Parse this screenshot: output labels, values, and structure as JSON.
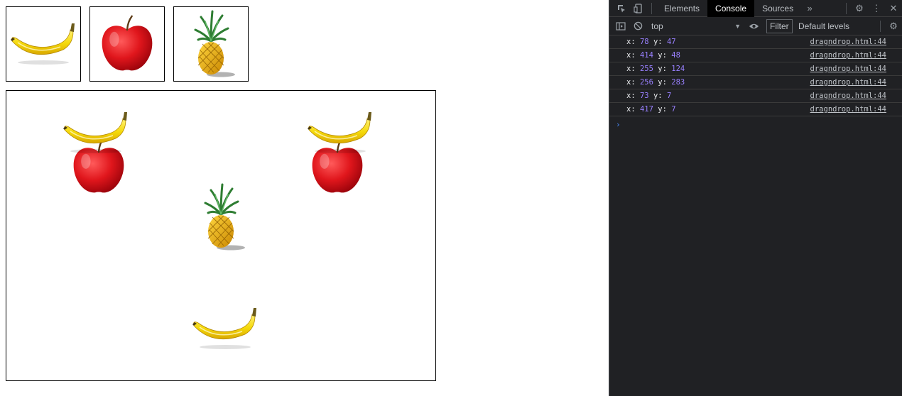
{
  "page": {
    "palette": [
      {
        "name": "banana",
        "icon": "banana-icon"
      },
      {
        "name": "apple",
        "icon": "apple-icon"
      },
      {
        "name": "pineapple",
        "icon": "pineapple-icon"
      }
    ],
    "placed_items": [
      "banana",
      "apple",
      "banana",
      "apple",
      "pineapple",
      "banana"
    ]
  },
  "devtools": {
    "tabs": [
      "Elements",
      "Console",
      "Sources"
    ],
    "active_tab": "Console",
    "more_tabs_icon": "double-chevron-icon",
    "context": "top",
    "filter_placeholder": "Filter",
    "levels": "Default levels",
    "logs": [
      {
        "x_label": "x:",
        "x": "78",
        "y_label": "y:",
        "y": "47",
        "source": "dragndrop.html:44"
      },
      {
        "x_label": "x:",
        "x": "414",
        "y_label": "y:",
        "y": "48",
        "source": "dragndrop.html:44"
      },
      {
        "x_label": "x:",
        "x": "255",
        "y_label": "y:",
        "y": "124",
        "source": "dragndrop.html:44"
      },
      {
        "x_label": "x:",
        "x": "256",
        "y_label": "y:",
        "y": "283",
        "source": "dragndrop.html:44"
      },
      {
        "x_label": "x:",
        "x": "73",
        "y_label": "y:",
        "y": "7",
        "source": "dragndrop.html:44"
      },
      {
        "x_label": "x:",
        "x": "417",
        "y_label": "y:",
        "y": "7",
        "source": "dragndrop.html:44"
      }
    ],
    "prompt_symbol": "›",
    "colors": {
      "number": "#9980ff",
      "background": "#202124",
      "active_tab": "#000000",
      "prompt": "#4a8cff"
    }
  }
}
